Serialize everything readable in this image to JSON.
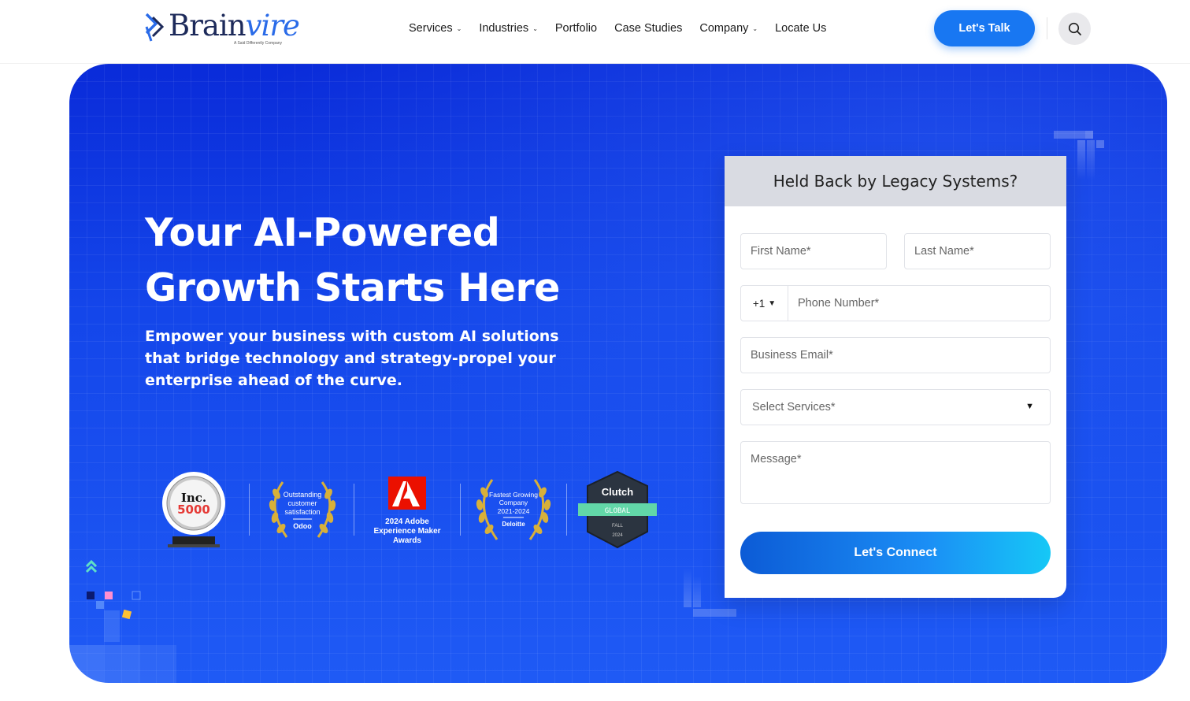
{
  "header": {
    "logo": {
      "brand_main": "Brain",
      "brand_accent": "vire",
      "tagline": "A Said Differently Company"
    },
    "nav": [
      {
        "label": "Services",
        "has_dropdown": true
      },
      {
        "label": "Industries",
        "has_dropdown": true
      },
      {
        "label": "Portfolio",
        "has_dropdown": false
      },
      {
        "label": "Case Studies",
        "has_dropdown": false
      },
      {
        "label": "Company",
        "has_dropdown": true
      },
      {
        "label": "Locate Us",
        "has_dropdown": false
      }
    ],
    "cta_label": "Let's Talk",
    "search_icon": "search-icon"
  },
  "hero": {
    "title_line1": "Your AI-Powered",
    "title_line2": "Growth Starts Here",
    "subtitle": "Empower your business with custom AI solutions that bridge technology and strategy-propel your enterprise ahead of the curve.",
    "awards": {
      "inc": {
        "name": "Inc.",
        "number": "5000"
      },
      "odoo": {
        "line1": "Outstanding",
        "line2": "customer",
        "line3": "satisfaction",
        "brand": "Odoo"
      },
      "adobe": {
        "line1": "2024 Adobe",
        "line2": "Experience Maker",
        "line3": "Awards"
      },
      "deloitte": {
        "line1": "Fastest Growing",
        "line2": "Company",
        "line3": "2021-2024",
        "brand": "Deloitte"
      },
      "clutch": {
        "brand": "Clutch",
        "ribbon": "GLOBAL",
        "season": "FALL",
        "year": "2024"
      }
    }
  },
  "form": {
    "title": "Held Back by Legacy Systems?",
    "first_name_placeholder": "First Name*",
    "last_name_placeholder": "Last Name*",
    "country_code": "+1",
    "phone_placeholder": "Phone Number*",
    "email_placeholder": "Business Email*",
    "services_placeholder": "Select Services*",
    "message_placeholder": "Message*",
    "submit_label": "Let's Connect"
  },
  "colors": {
    "primary_blue": "#1877f2",
    "hero_top": "#0a2bd9",
    "hero_bottom": "#1f5af5",
    "form_header": "#d9dbe2"
  }
}
